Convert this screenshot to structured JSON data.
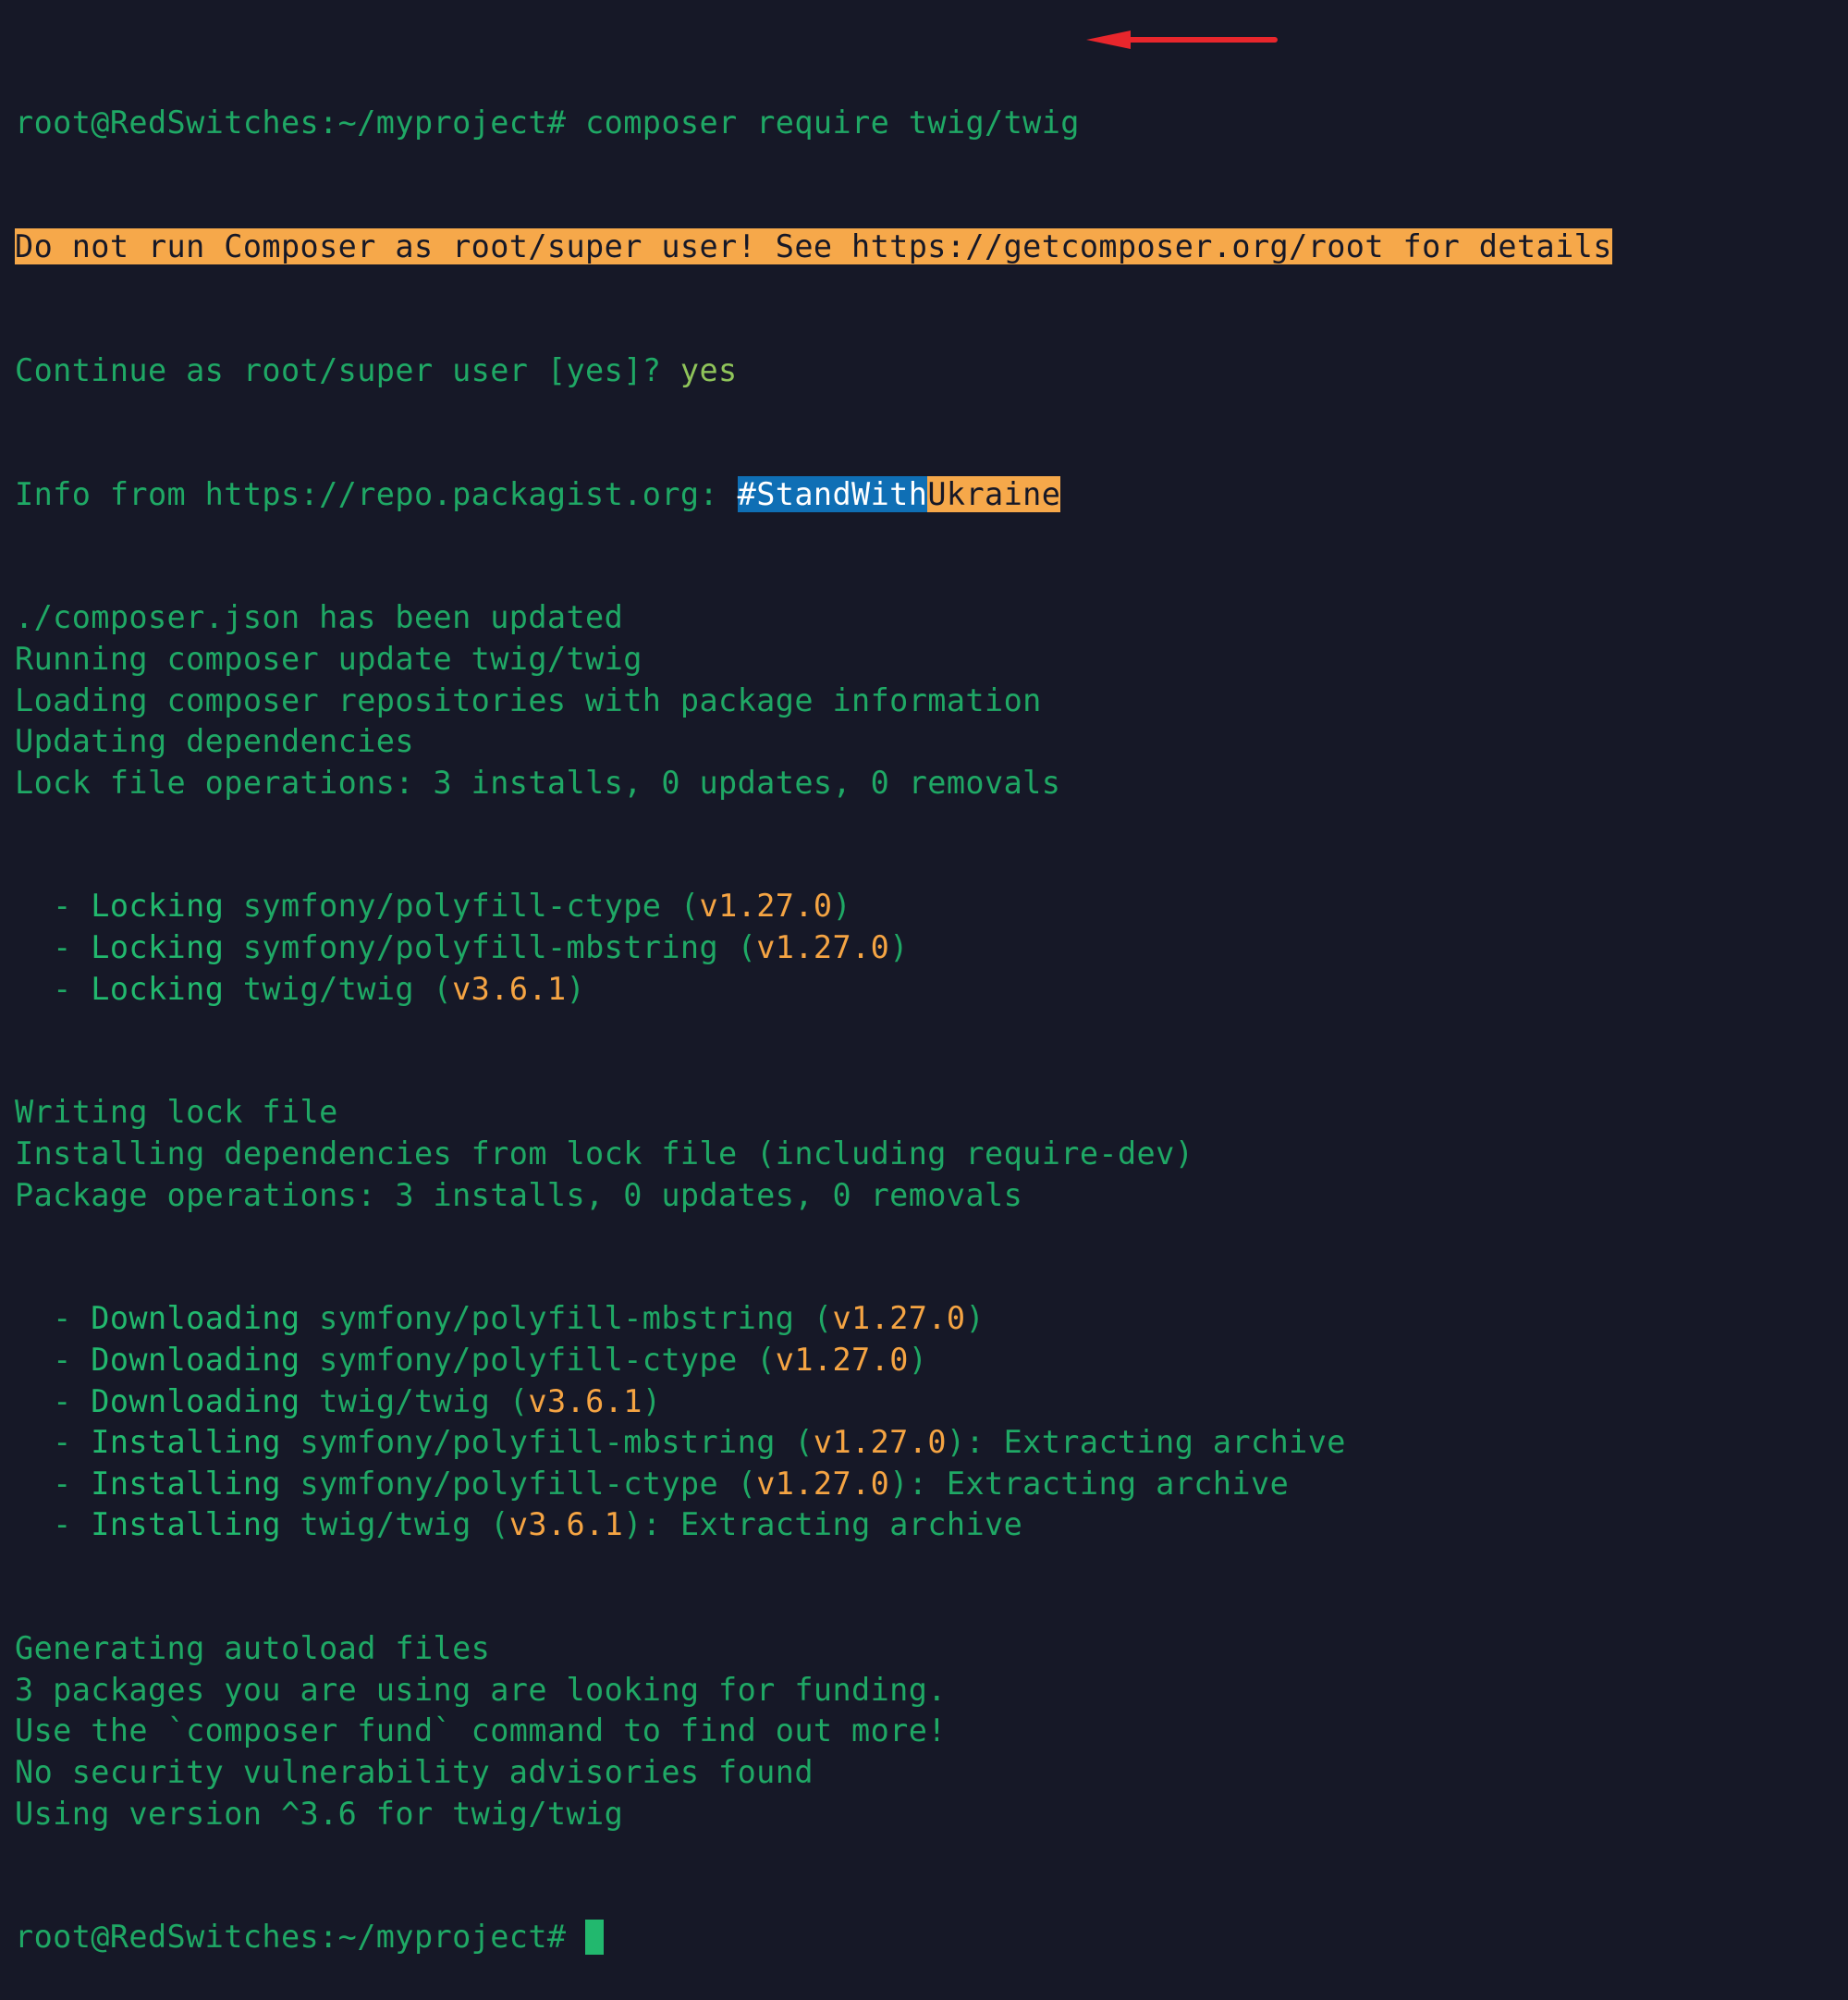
{
  "terminal": {
    "prompt": "root@RedSwitches:~/myproject#",
    "command": "composer require twig/twig",
    "warning": "Do not run Composer as root/super user! See https://getcomposer.org/root for details",
    "continue_prompt": "Continue as root/super user [yes]?",
    "continue_answer": "yes",
    "info_prefix": "Info from https://repo.packagist.org: ",
    "info_blue": "#StandWith",
    "info_orange": "Ukraine",
    "lines_a": [
      "./composer.json has been updated",
      "Running composer update twig/twig",
      "Loading composer repositories with package information",
      "Updating dependencies",
      "Lock file operations: 3 installs, 0 updates, 0 removals"
    ],
    "lock_ops": [
      {
        "action": "Locking",
        "package": "symfony/polyfill-ctype",
        "version": "v1.27.0",
        "suffix": ""
      },
      {
        "action": "Locking",
        "package": "symfony/polyfill-mbstring",
        "version": "v1.27.0",
        "suffix": ""
      },
      {
        "action": "Locking",
        "package": "twig/twig",
        "version": "v3.6.1",
        "suffix": ""
      }
    ],
    "lines_b": [
      "Writing lock file",
      "Installing dependencies from lock file (including require-dev)",
      "Package operations: 3 installs, 0 updates, 0 removals"
    ],
    "pkg_ops": [
      {
        "action": "Downloading",
        "package": "symfony/polyfill-mbstring",
        "version": "v1.27.0",
        "suffix": ""
      },
      {
        "action": "Downloading",
        "package": "symfony/polyfill-ctype",
        "version": "v1.27.0",
        "suffix": ""
      },
      {
        "action": "Downloading",
        "package": "twig/twig",
        "version": "v3.6.1",
        "suffix": ""
      },
      {
        "action": "Installing",
        "package": "symfony/polyfill-mbstring",
        "version": "v1.27.0",
        "suffix": ": Extracting archive"
      },
      {
        "action": "Installing",
        "package": "symfony/polyfill-ctype",
        "version": "v1.27.0",
        "suffix": ": Extracting archive"
      },
      {
        "action": "Installing",
        "package": "twig/twig",
        "version": "v3.6.1",
        "suffix": ": Extracting archive"
      }
    ],
    "lines_c": [
      "Generating autoload files",
      "3 packages you are using are looking for funding.",
      "Use the `composer fund` command to find out more!",
      "No security vulnerability advisories found",
      "Using version ^3.6 for twig/twig"
    ]
  },
  "annotation": {
    "arrow_color": "#e8262c"
  }
}
